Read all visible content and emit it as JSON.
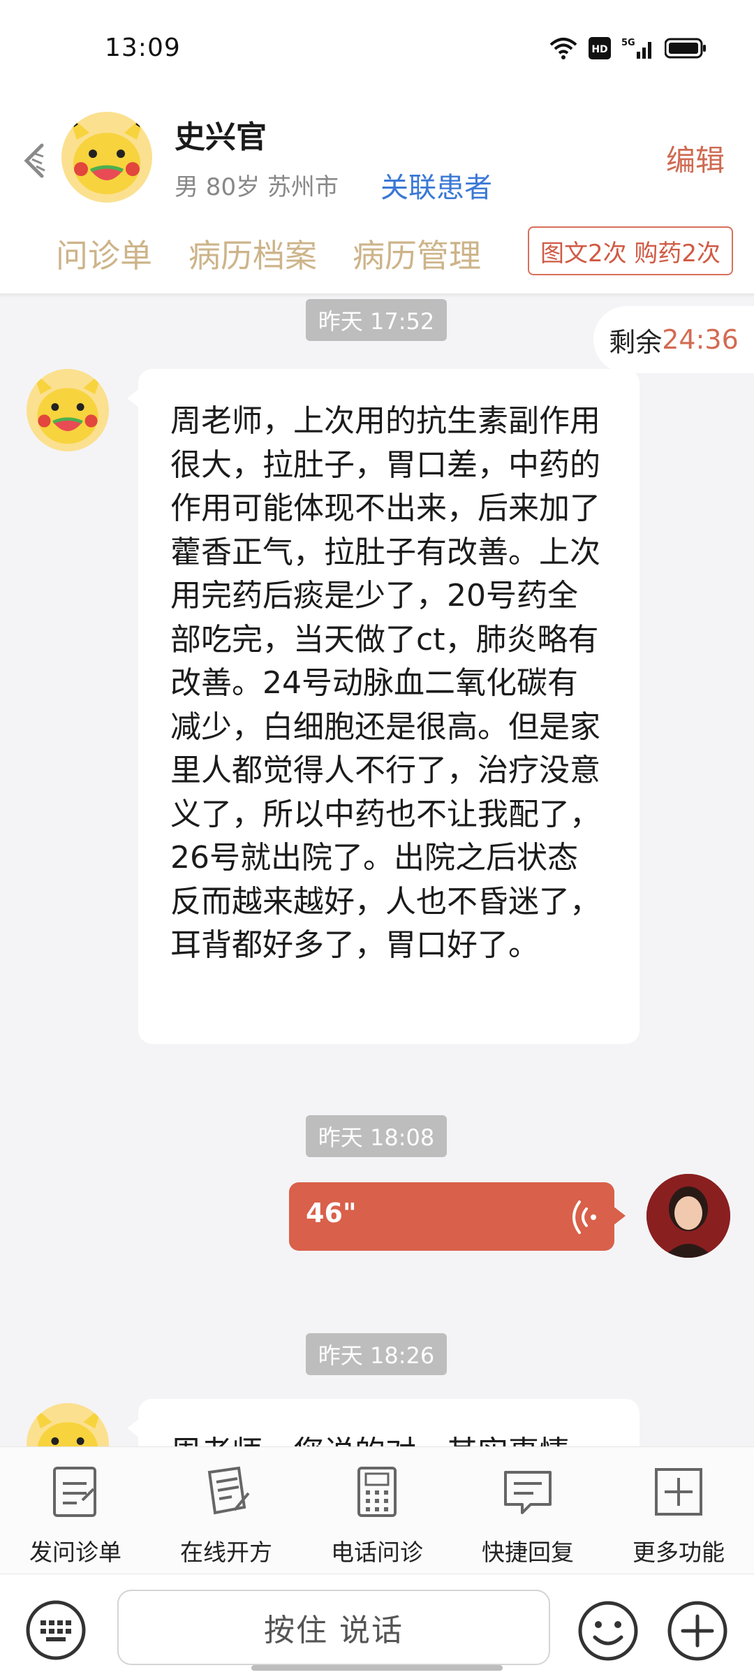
{
  "status_bar": {
    "time": "13:09",
    "icons": [
      "wifi-icon",
      "hd-icon",
      "5g-signal-icon",
      "battery-icon"
    ],
    "hd_label": "HD",
    "network_label": "5G"
  },
  "header": {
    "back_icon": "back-icon",
    "patient_name": "史兴官",
    "patient_meta": "男 80岁  苏州市",
    "link_patient": "关联患者",
    "edit": "编辑",
    "tabs": [
      "问诊单",
      "病历档案",
      "病历管理"
    ],
    "quota_badge": "图文2次 购药2次"
  },
  "chat": {
    "remaining_label": "剩余",
    "remaining_time": "24:36",
    "messages": [
      {
        "time": "昨天 17:52"
      },
      {
        "text": "周老师，上次用的抗生素副作用很大，拉肚子，胃口差，中药的作用可能体现不出来，后来加了藿香正气，拉肚子有改善。上次用完药后痰是少了，20号药全部吃完，当天做了ct，肺炎略有改善。24号动脉血二氧化碳有减少，白细胞还是很高。但是家里人都觉得人不行了，治疗没意义了，所以中药也不让我配了，26号就出院了。出院之后状态反而越来越好，人也不昏迷了，耳背都好多了，胃口好了。"
      },
      {
        "time": "昨天 18:08"
      },
      {
        "voice_duration": "46\""
      },
      {
        "time": "昨天 18:26"
      },
      {
        "text": "周老师，您说的对，其实事情"
      }
    ]
  },
  "toolbar": {
    "items": [
      {
        "label": "发问诊单",
        "icon": "form-icon"
      },
      {
        "label": "在线开方",
        "icon": "prescription-icon"
      },
      {
        "label": "电话问诊",
        "icon": "phone-icon"
      },
      {
        "label": "快捷回复",
        "icon": "quick-reply-icon"
      },
      {
        "label": "更多功能",
        "icon": "more-icon"
      }
    ]
  },
  "input_bar": {
    "hold_to_talk": "按住 说话",
    "icons": [
      "keyboard-icon",
      "emoji-icon",
      "plus-icon"
    ]
  },
  "colors": {
    "accent": "#d9604a",
    "link": "#3a78d6",
    "tab_text": "#cdb48a",
    "time_pill": "#bdbdbd",
    "background": "#f4f4f6"
  }
}
